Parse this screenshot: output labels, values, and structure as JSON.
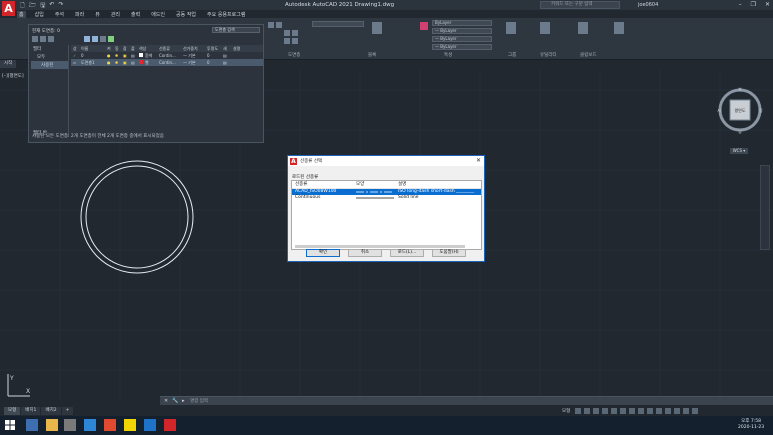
{
  "app": {
    "title": "Autodesk AutoCAD 2021   Drawing1.dwg",
    "logo": "A",
    "search_placeholder": "키워드 또는 구문 입력",
    "user": "joe0604",
    "window_controls": [
      "–",
      "❐",
      "✕"
    ]
  },
  "ribbon": {
    "tabs": [
      "홈",
      "삽입",
      "주석",
      "파라",
      "뷰",
      "관리",
      "출력",
      "애드인",
      "공동 작업",
      "주요 응용프로그램"
    ],
    "active_tab": "홈",
    "panels": {
      "layers_title": "도면층",
      "block_title": "블록",
      "properties_title": "특성",
      "group_title": "그룹",
      "utilities_title": "유틸리티",
      "clipboard_title": "클립보드",
      "bylayer_1": "ByLayer",
      "bylayer_2": "— ByLayer",
      "bylayer_3": "— ByLayer",
      "bylayer_4": "— ByLayer"
    }
  },
  "file_tabs": [
    "시작"
  ],
  "viewport_label": "[–][평면도]",
  "layer_manager": {
    "current_layer": "현재 도면층: 0",
    "search_placeholder": "도면층 검색",
    "filter_header": "필터",
    "filter_all": "모두",
    "filter_used": "사용된",
    "invert_filter": "필터 반",
    "columns": [
      "상",
      "이름",
      "켜",
      "동",
      "잠",
      "플",
      "색상",
      "선종류",
      "선가중치",
      "투명도",
      "새",
      "설명"
    ],
    "rows": [
      {
        "status": "✓",
        "name": "0",
        "color": "흰색",
        "linetype": "Contin...",
        "lineweight": "— 기본",
        "transparency": "0"
      },
      {
        "status": "▱",
        "name": "도면층1",
        "color": "빨",
        "linetype": "Contin...",
        "lineweight": "— 기본",
        "transparency": "0"
      }
    ],
    "status_text": "사용된 모든 도면층: 2개 도면층이 전체 2개 도면층 중에서 표시되었음"
  },
  "viewcube": {
    "face": "평면도",
    "north": "북",
    "south": "남",
    "east": "동",
    "west": "서",
    "wcs": "WCS ▾"
  },
  "dialog": {
    "title": "선종류 선택",
    "loaded_label": "로드된 선종류",
    "columns": [
      "선종류",
      "모양",
      "설명"
    ],
    "rows": [
      {
        "linetype": "ACAD_ISO08W100",
        "description": "ISO long-dash short-dash ________",
        "selected": true
      },
      {
        "linetype": "Continuous",
        "description": "Solid line",
        "selected": false
      }
    ],
    "buttons": {
      "ok": "확인",
      "cancel": "취소",
      "load": "로드(L)...",
      "help": "도움말(H)"
    },
    "close": "✕"
  },
  "command_line": {
    "placeholder": "명령 입력"
  },
  "layout_tabs": [
    "모형",
    "배치1",
    "배치2",
    "+"
  ],
  "status_bar": {
    "model": "모형"
  },
  "ucs": {
    "x": "X",
    "y": "Y"
  },
  "taskbar": {
    "time": "오후 7:58",
    "date": "2020-11-23",
    "accent": "#d3262b"
  }
}
